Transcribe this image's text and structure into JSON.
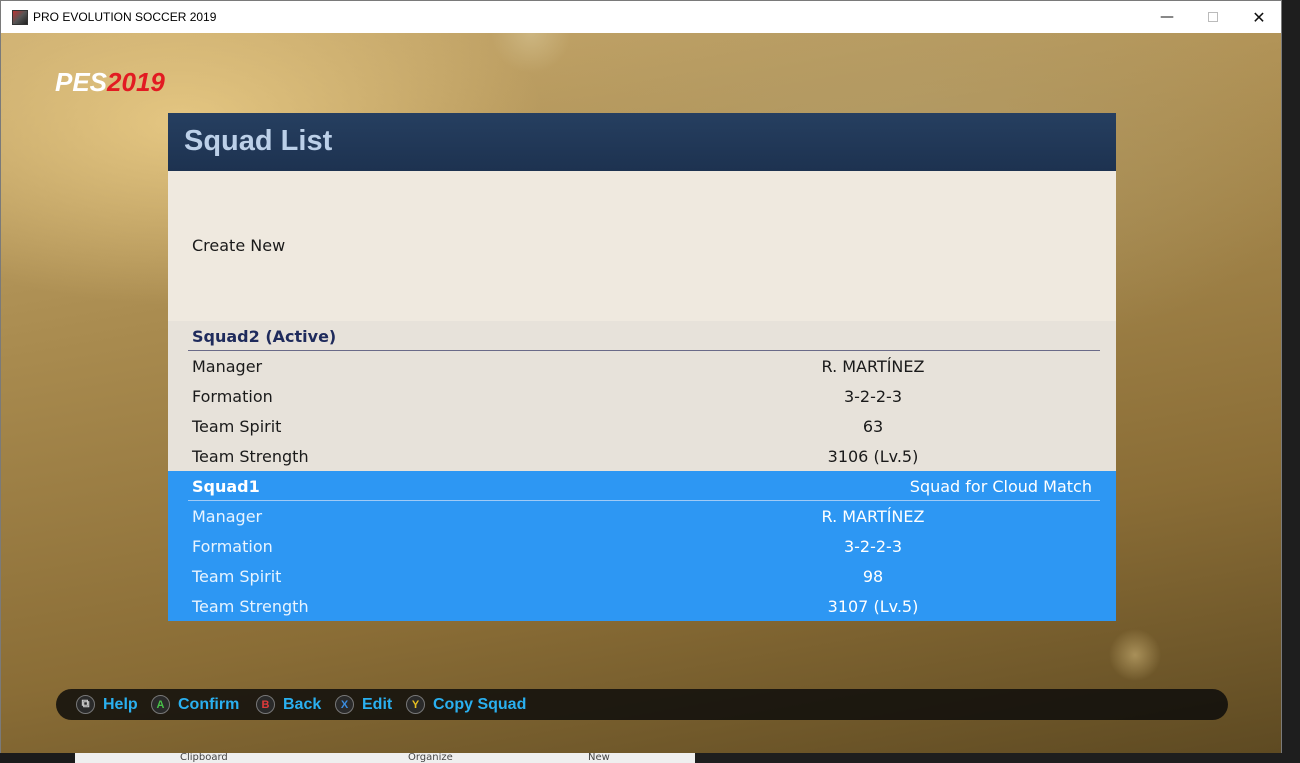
{
  "window": {
    "title": "PRO EVOLUTION SOCCER 2019",
    "min_symbol": "—",
    "close_symbol": "✕"
  },
  "logo": {
    "pes": "PES",
    "year": "2019"
  },
  "panel": {
    "title": "Squad List",
    "create_new": "Create New"
  },
  "squads": [
    {
      "name": "Squad2 (Active)",
      "tag": "",
      "rows": [
        {
          "label": "Manager",
          "value": "R. MARTÍNEZ"
        },
        {
          "label": "Formation",
          "value": "3-2-2-3"
        },
        {
          "label": "Team Spirit",
          "value": "63"
        },
        {
          "label": "Team Strength",
          "value": "3106 (Lv.5)"
        }
      ]
    },
    {
      "name": "Squad1",
      "tag": "Squad for Cloud Match",
      "rows": [
        {
          "label": "Manager",
          "value": "R. MARTÍNEZ"
        },
        {
          "label": "Formation",
          "value": "3-2-2-3"
        },
        {
          "label": "Team Spirit",
          "value": "98"
        },
        {
          "label": "Team Strength",
          "value": "3107 (Lv.5)"
        }
      ]
    }
  ],
  "controls": [
    {
      "key": "⧉",
      "key_color": "#cfcfcf",
      "label": "Help"
    },
    {
      "key": "A",
      "key_color": "#48c048",
      "label": "Confirm"
    },
    {
      "key": "B",
      "key_color": "#e03a3a",
      "label": "Back"
    },
    {
      "key": "X",
      "key_color": "#3a8de0",
      "label": "Edit"
    },
    {
      "key": "Y",
      "key_color": "#e8c020",
      "label": "Copy Squad"
    }
  ],
  "background_taskbar": {
    "items": [
      "Clipboard",
      "Organize",
      "New"
    ]
  },
  "colors": {
    "header_bg": "#1d3250",
    "highlight": "#2d97f3",
    "control_text": "#2ab0f0",
    "logo_red": "#e21b22"
  }
}
